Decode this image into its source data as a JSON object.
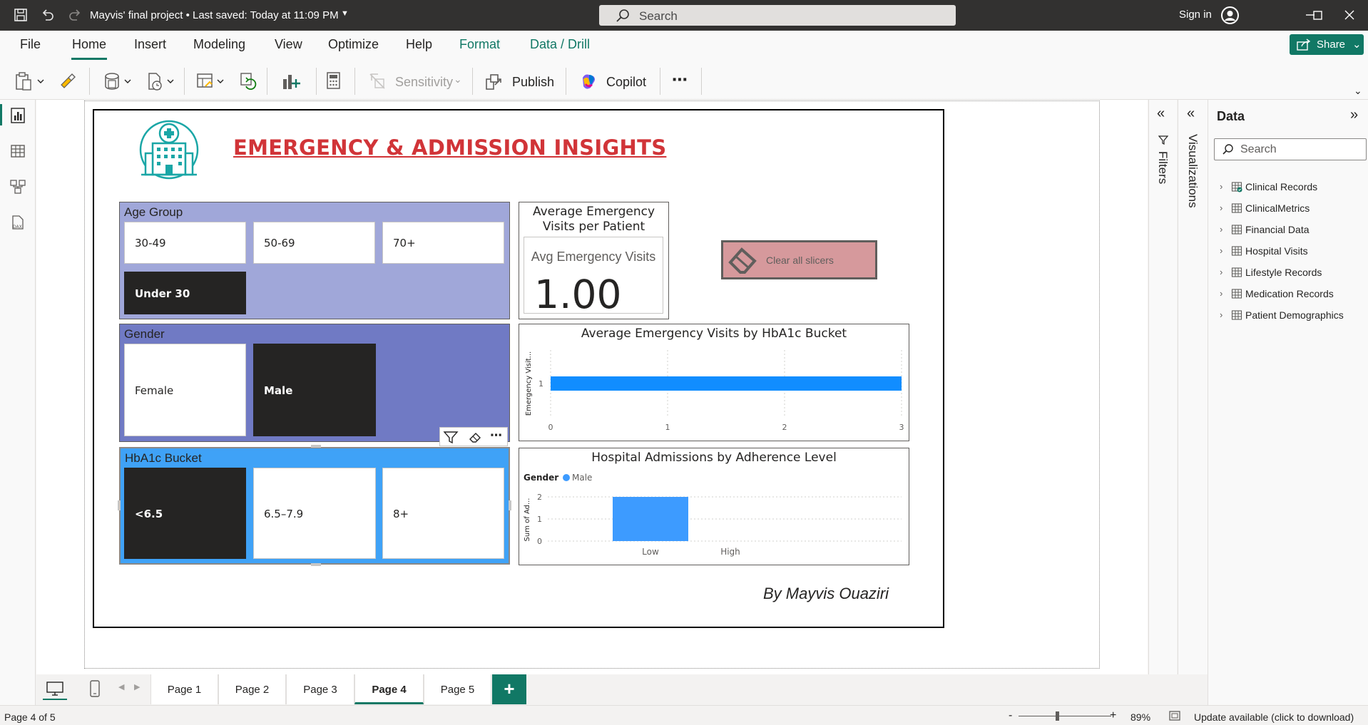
{
  "titlebar": {
    "doc_title": "Mayvis' final project • Last saved: Today at 11:09 PM",
    "search_placeholder": "Search",
    "sign_in": "Sign in"
  },
  "ribbon": {
    "tabs": [
      "File",
      "Home",
      "Insert",
      "Modeling",
      "View",
      "Optimize",
      "Help",
      "Format",
      "Data / Drill"
    ],
    "active_tab": "Home",
    "share_label": "Share",
    "sensitivity_label": "Sensitivity",
    "publish_label": "Publish",
    "copilot_label": "Copilot",
    "more_label": "⋯"
  },
  "report": {
    "title": "EMERGENCY & ADMISSION INSIGHTS",
    "author": "By Mayvis Ouaziri",
    "clear_slicers_label": "Clear all slicers",
    "slicers": {
      "age_group": {
        "title": "Age Group",
        "items": [
          "30-49",
          "50-69",
          "70+",
          "Under 30"
        ],
        "selected": "Under 30"
      },
      "gender": {
        "title": "Gender",
        "items": [
          "Female",
          "Male"
        ],
        "selected": "Male"
      },
      "hba1c": {
        "title": "HbA1c Bucket",
        "items": [
          "<6.5",
          "6.5–7.9",
          "8+"
        ],
        "selected": "<6.5"
      }
    },
    "avg_card": {
      "title": "Average Emergency Visits per Patient",
      "label": "Avg Emergency Visits",
      "value": "1.00"
    }
  },
  "chart_data": [
    {
      "type": "bar",
      "orientation": "horizontal",
      "title": "Average Emergency Visits by HbA1c Bucket",
      "ylabel": "Emergency Visit...",
      "categories": [
        "1"
      ],
      "values": [
        3
      ],
      "xlim": [
        0,
        3
      ],
      "xticks": [
        "0",
        "1",
        "2",
        "3"
      ],
      "bar_color": "#118dff",
      "grid": true
    },
    {
      "type": "bar",
      "title": "Hospital Admissions by Adherence Level",
      "legend_title": "Gender",
      "legend": [
        {
          "name": "Male",
          "color": "#3d9bff"
        }
      ],
      "legend_position": "top-left",
      "ylabel": "Sum of Ad...",
      "categories": [
        "Low",
        "High"
      ],
      "series": [
        {
          "name": "Male",
          "values": [
            2,
            0
          ]
        }
      ],
      "ylim": [
        0,
        2
      ],
      "yticks": [
        "0",
        "1",
        "2"
      ],
      "grid": true
    }
  ],
  "panes": {
    "filters_label": "Filters",
    "visualizations_label": "Visualizations",
    "data_title": "Data",
    "data_search_placeholder": "Search",
    "tables": [
      "Clinical Records",
      "ClinicalMetrics",
      "Financial Data",
      "Hospital Visits",
      "Lifestyle Records",
      "Medication Records",
      "Patient Demographics"
    ]
  },
  "pages": {
    "tabs": [
      "Page 1",
      "Page 2",
      "Page 3",
      "Page 4",
      "Page 5"
    ],
    "active": "Page 4",
    "add_label": "+"
  },
  "status": {
    "page_indicator": "Page 4 of 5",
    "zoom_minus": "-",
    "zoom_plus": "+",
    "zoom": "89%",
    "update": "Update available (click to download)"
  },
  "colors": {
    "accent": "#117865",
    "title_red": "#d13438",
    "age_slicer_bg": "#a0a7d9",
    "gender_slicer_bg": "#707ac4",
    "hba1c_slicer_bg": "#3fa2f7",
    "selected_item": "#252423",
    "icon_teal": "#1aa6a6"
  }
}
